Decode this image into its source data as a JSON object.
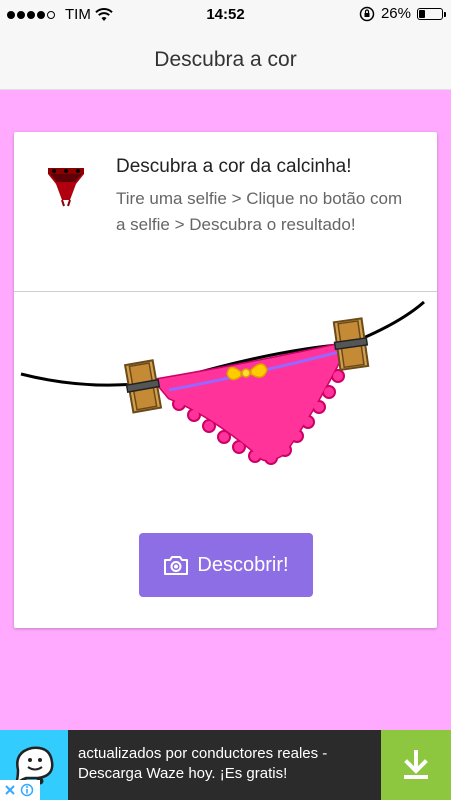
{
  "status_bar": {
    "carrier": "TIM",
    "time": "14:52",
    "battery": "26%",
    "battery_level": 0.26
  },
  "nav": {
    "title": "Descubra a cor"
  },
  "card": {
    "title": "Descubra a cor da calcinha!",
    "description": "Tire uma selfie > Clique no botão com a selfie > Descubra o resultado!",
    "button_label": "Descobrir!"
  },
  "ad": {
    "text": "actualizados por conductores reales - Descarga Waze hoy. ¡Es gratis!"
  },
  "icons": {
    "signal": "signal-dots-icon",
    "wifi": "wifi-icon",
    "orientation_lock": "orientation-lock-icon",
    "camera": "camera-icon",
    "waze": "waze-icon",
    "download": "download-icon",
    "close": "close-icon",
    "info": "info-icon"
  },
  "colors": {
    "background": "#ffaaff",
    "button": "#8e6ee5",
    "panty": "#ff3399",
    "ad_download": "#8dc63f",
    "waze": "#33ccff"
  }
}
